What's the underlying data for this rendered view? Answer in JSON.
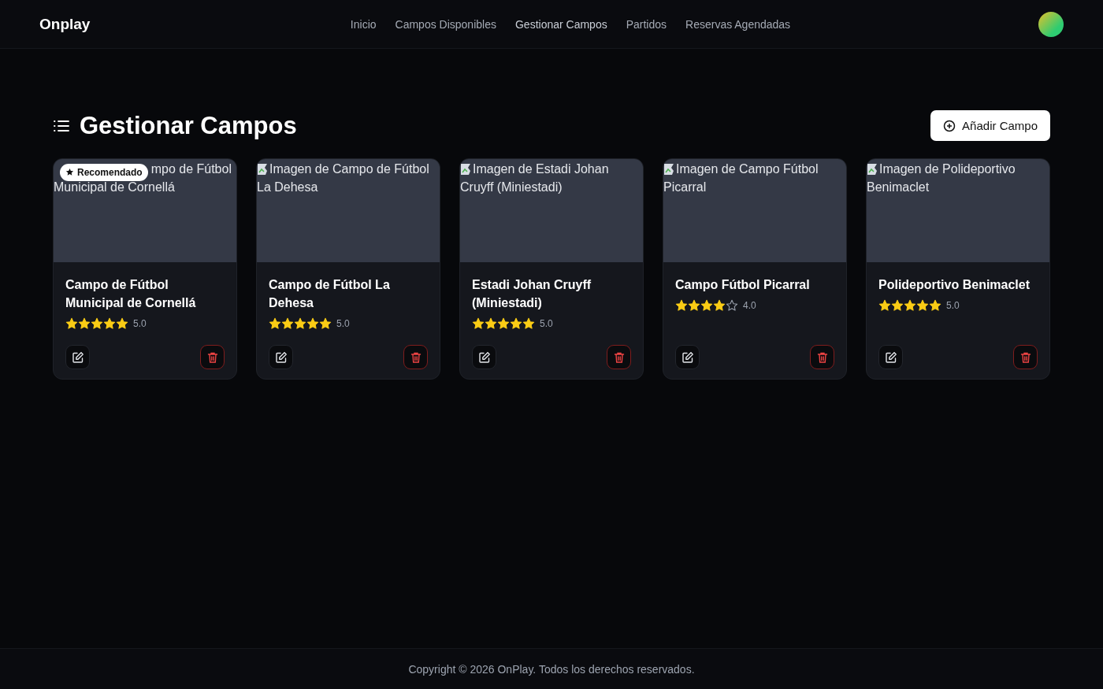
{
  "navbar": {
    "brand": "Onplay",
    "links": [
      {
        "label": "Inicio",
        "selected": false
      },
      {
        "label": "Campos Disponibles",
        "selected": false
      },
      {
        "label": "Gestionar Campos",
        "selected": true
      },
      {
        "label": "Partidos",
        "selected": false
      },
      {
        "label": "Reservas Agendadas",
        "selected": false
      }
    ]
  },
  "page": {
    "title": "Gestionar Campos",
    "add_button": "Añadir Campo"
  },
  "fields": [
    {
      "image_alt_lines": [
        "mpo de Fútbol",
        "Municipal de Cornellá"
      ],
      "badge": "Recomendado",
      "name": "Campo de Fútbol Municipal de Cornellá",
      "stars": 5,
      "rating": "5.0"
    },
    {
      "image_alt_lines": [
        "Imagen de Campo de Fútbol",
        "La Dehesa"
      ],
      "name": "Campo de Fútbol La Dehesa",
      "stars": 5,
      "rating": "5.0"
    },
    {
      "image_alt_lines": [
        "Imagen de Estadi Johan",
        "Cruyff (Miniestadi)"
      ],
      "name": "Estadi Johan Cruyff (Miniestadi)",
      "stars": 5,
      "rating": "5.0"
    },
    {
      "image_alt_lines": [
        "Imagen de Campo Fútbol",
        "Picarral"
      ],
      "name": "Campo Fútbol Picarral",
      "stars": 4,
      "rating": "4.0"
    },
    {
      "image_alt_lines": [
        "Imagen de Polideportivo",
        "Benimaclet"
      ],
      "name": "Polideportivo Benimaclet",
      "stars": 5,
      "rating": "5.0"
    }
  ],
  "footer": "Copyright © 2026 OnPlay. Todos los derechos reservados."
}
